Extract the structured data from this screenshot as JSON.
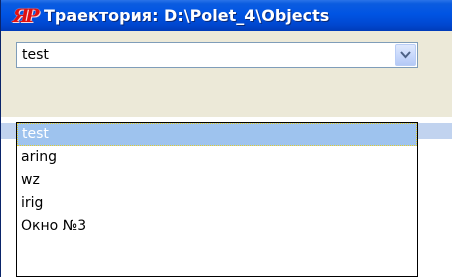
{
  "window": {
    "icon_text": "ЯР",
    "title": "Траектория: D:\\Polet_4\\Objects"
  },
  "combobox": {
    "value": "test",
    "button_icon": "chevron-down-icon"
  },
  "dropdown": {
    "items": [
      {
        "label": "test",
        "selected": true
      },
      {
        "label": "aring",
        "selected": false
      },
      {
        "label": "wz",
        "selected": false
      },
      {
        "label": "irig",
        "selected": false
      },
      {
        "label": "Окно №3",
        "selected": false
      }
    ]
  },
  "colors": {
    "titlebar": "#0054e3",
    "selection": "#9ec3ee",
    "toolbar": "#ece9d8"
  }
}
